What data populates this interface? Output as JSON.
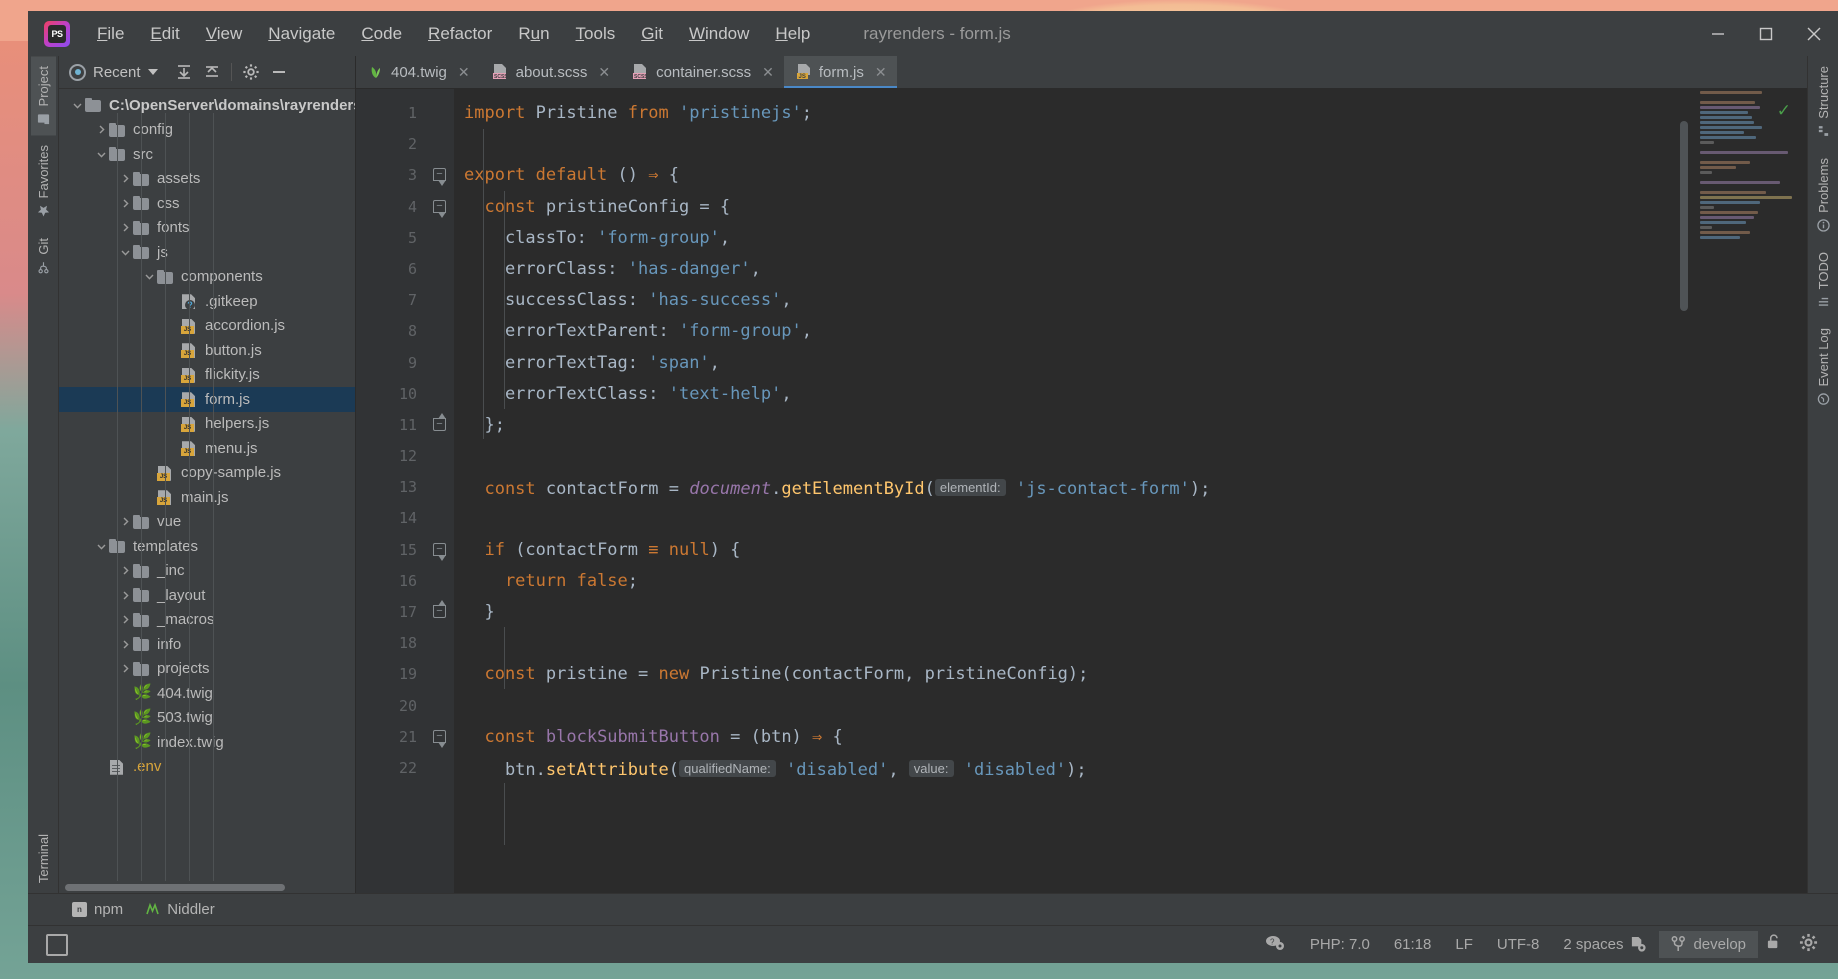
{
  "window": {
    "title": "rayrenders - form.js",
    "logo_label": "PS",
    "minimize": "–",
    "maximize": "□",
    "close": "✕"
  },
  "menubar": [
    {
      "label": "File",
      "mnemonic": "F"
    },
    {
      "label": "Edit",
      "mnemonic": "E"
    },
    {
      "label": "View",
      "mnemonic": "V"
    },
    {
      "label": "Navigate",
      "mnemonic": "N"
    },
    {
      "label": "Code",
      "mnemonic": "C"
    },
    {
      "label": "Refactor",
      "mnemonic": "R"
    },
    {
      "label": "Run",
      "mnemonic": "u"
    },
    {
      "label": "Tools",
      "mnemonic": "T"
    },
    {
      "label": "Git",
      "mnemonic": "G"
    },
    {
      "label": "Window",
      "mnemonic": "W"
    },
    {
      "label": "Help",
      "mnemonic": "H"
    }
  ],
  "left_strip": [
    {
      "label": "Project",
      "active": true,
      "icon": "project-icon"
    },
    {
      "label": "Favorites",
      "active": false,
      "icon": "star-icon"
    },
    {
      "label": "Git",
      "active": false,
      "icon": "branch-icon"
    }
  ],
  "left_strip_bottom": [
    {
      "label": "Terminal",
      "active": false,
      "icon": "terminal-icon"
    }
  ],
  "right_strip": [
    {
      "label": "Structure",
      "active": false,
      "icon": "structure-icon"
    },
    {
      "label": "Problems",
      "active": false,
      "icon": "warning-icon"
    },
    {
      "label": "TODO",
      "active": false,
      "icon": "todo-icon"
    },
    {
      "label": "Event Log",
      "active": false,
      "icon": "log-icon"
    }
  ],
  "project_panel": {
    "scope_label": "Recent",
    "toolbar_buttons": [
      {
        "name": "expand-all-button",
        "glyph": "⤓"
      },
      {
        "name": "collapse-all-button",
        "glyph": "⤒"
      },
      {
        "name": "settings-button",
        "glyph": "⚙"
      },
      {
        "name": "hide-button",
        "glyph": "—"
      }
    ],
    "tree": [
      {
        "label": "C:\\OpenServer\\domains\\rayrenders",
        "depth": 0,
        "arrow": "down",
        "icon": "folder",
        "bold": true,
        "selected": false
      },
      {
        "label": "config",
        "depth": 1,
        "arrow": "right",
        "icon": "folder",
        "bold": false,
        "selected": false
      },
      {
        "label": "src",
        "depth": 1,
        "arrow": "down",
        "icon": "folder",
        "bold": false,
        "selected": false
      },
      {
        "label": "assets",
        "depth": 2,
        "arrow": "right",
        "icon": "folder",
        "bold": false,
        "selected": false
      },
      {
        "label": "css",
        "depth": 2,
        "arrow": "right",
        "icon": "folder",
        "bold": false,
        "selected": false
      },
      {
        "label": "fonts",
        "depth": 2,
        "arrow": "right",
        "icon": "folder",
        "bold": false,
        "selected": false
      },
      {
        "label": "js",
        "depth": 2,
        "arrow": "down",
        "icon": "folder",
        "bold": false,
        "selected": false
      },
      {
        "label": "components",
        "depth": 3,
        "arrow": "down",
        "icon": "folder",
        "bold": false,
        "selected": false
      },
      {
        "label": ".gitkeep",
        "depth": 4,
        "arrow": "none",
        "icon": "gitkeep",
        "bold": false,
        "selected": false
      },
      {
        "label": "accordion.js",
        "depth": 4,
        "arrow": "none",
        "icon": "js",
        "bold": false,
        "selected": false
      },
      {
        "label": "button.js",
        "depth": 4,
        "arrow": "none",
        "icon": "js",
        "bold": false,
        "selected": false
      },
      {
        "label": "flickity.js",
        "depth": 4,
        "arrow": "none",
        "icon": "js",
        "bold": false,
        "selected": false
      },
      {
        "label": "form.js",
        "depth": 4,
        "arrow": "none",
        "icon": "js",
        "bold": false,
        "selected": true
      },
      {
        "label": "helpers.js",
        "depth": 4,
        "arrow": "none",
        "icon": "js",
        "bold": false,
        "selected": false
      },
      {
        "label": "menu.js",
        "depth": 4,
        "arrow": "none",
        "icon": "js",
        "bold": false,
        "selected": false
      },
      {
        "label": "copy-sample.js",
        "depth": 3,
        "arrow": "none",
        "icon": "js",
        "bold": false,
        "selected": false
      },
      {
        "label": "main.js",
        "depth": 3,
        "arrow": "none",
        "icon": "js",
        "bold": false,
        "selected": false
      },
      {
        "label": "vue",
        "depth": 2,
        "arrow": "right",
        "icon": "folder",
        "bold": false,
        "selected": false
      },
      {
        "label": "templates",
        "depth": 1,
        "arrow": "down",
        "icon": "folder",
        "bold": false,
        "selected": false
      },
      {
        "label": "_inc",
        "depth": 2,
        "arrow": "right",
        "icon": "folder",
        "bold": false,
        "selected": false
      },
      {
        "label": "_layout",
        "depth": 2,
        "arrow": "right",
        "icon": "folder",
        "bold": false,
        "selected": false
      },
      {
        "label": "_macros",
        "depth": 2,
        "arrow": "right",
        "icon": "folder",
        "bold": false,
        "selected": false
      },
      {
        "label": "info",
        "depth": 2,
        "arrow": "right",
        "icon": "folder",
        "bold": false,
        "selected": false
      },
      {
        "label": "projects",
        "depth": 2,
        "arrow": "right",
        "icon": "folder",
        "bold": false,
        "selected": false
      },
      {
        "label": "404.twig",
        "depth": 2,
        "arrow": "none",
        "icon": "twig",
        "bold": false,
        "selected": false
      },
      {
        "label": "503.twig",
        "depth": 2,
        "arrow": "none",
        "icon": "twig",
        "bold": false,
        "selected": false
      },
      {
        "label": "index.twig",
        "depth": 2,
        "arrow": "none",
        "icon": "twig",
        "bold": false,
        "selected": false
      },
      {
        "label": ".env",
        "depth": 1,
        "arrow": "none",
        "icon": "env",
        "bold": false,
        "selected": false
      }
    ]
  },
  "editor_tabs": [
    {
      "label": "404.twig",
      "icon": "twig",
      "active": false,
      "closable": true
    },
    {
      "label": "about.scss",
      "icon": "scss",
      "active": false,
      "closable": true
    },
    {
      "label": "container.scss",
      "icon": "scss",
      "active": false,
      "closable": true
    },
    {
      "label": "form.js",
      "icon": "js",
      "active": true,
      "closable": true
    }
  ],
  "editor": {
    "first_line": 1,
    "inspection_status": "✓",
    "lines": [
      {
        "n": 1,
        "fold": "",
        "segs": [
          {
            "t": "import ",
            "c": "kw"
          },
          {
            "t": "Pristine ",
            "c": "plain"
          },
          {
            "t": "from ",
            "c": "kw"
          },
          {
            "t": "'pristinejs'",
            "c": "str"
          },
          {
            "t": ";",
            "c": "plain"
          }
        ]
      },
      {
        "n": 2,
        "fold": "",
        "segs": []
      },
      {
        "n": 3,
        "fold": "open",
        "segs": [
          {
            "t": "export default ",
            "c": "kw"
          },
          {
            "t": "() ",
            "c": "plain"
          },
          {
            "t": "⇒",
            "c": "kw"
          },
          {
            "t": " {",
            "c": "plain"
          }
        ]
      },
      {
        "n": 4,
        "fold": "open",
        "indent": 1,
        "segs": [
          {
            "t": "  const ",
            "c": "kw"
          },
          {
            "t": "pristineConfig = {",
            "c": "plain"
          }
        ]
      },
      {
        "n": 5,
        "fold": "",
        "indent": 2,
        "segs": [
          {
            "t": "    classTo",
            "c": "plain"
          },
          {
            "t": ": ",
            "c": "plain"
          },
          {
            "t": "'form-group'",
            "c": "str"
          },
          {
            "t": ",",
            "c": "plain"
          }
        ]
      },
      {
        "n": 6,
        "fold": "",
        "indent": 2,
        "segs": [
          {
            "t": "    errorClass",
            "c": "plain"
          },
          {
            "t": ": ",
            "c": "plain"
          },
          {
            "t": "'has-danger'",
            "c": "str"
          },
          {
            "t": ",",
            "c": "plain"
          }
        ]
      },
      {
        "n": 7,
        "fold": "",
        "indent": 2,
        "segs": [
          {
            "t": "    successClass",
            "c": "plain"
          },
          {
            "t": ": ",
            "c": "plain"
          },
          {
            "t": "'has-success'",
            "c": "str"
          },
          {
            "t": ",",
            "c": "plain"
          }
        ]
      },
      {
        "n": 8,
        "fold": "",
        "indent": 2,
        "segs": [
          {
            "t": "    errorTextParent",
            "c": "plain"
          },
          {
            "t": ": ",
            "c": "plain"
          },
          {
            "t": "'form-group'",
            "c": "str"
          },
          {
            "t": ",",
            "c": "plain"
          }
        ]
      },
      {
        "n": 9,
        "fold": "",
        "indent": 2,
        "segs": [
          {
            "t": "    errorTextTag",
            "c": "plain"
          },
          {
            "t": ": ",
            "c": "plain"
          },
          {
            "t": "'span'",
            "c": "str"
          },
          {
            "t": ",",
            "c": "plain"
          }
        ]
      },
      {
        "n": 10,
        "fold": "",
        "indent": 2,
        "segs": [
          {
            "t": "    errorTextClass",
            "c": "plain"
          },
          {
            "t": ": ",
            "c": "plain"
          },
          {
            "t": "'text-help'",
            "c": "str"
          },
          {
            "t": ",",
            "c": "plain"
          }
        ]
      },
      {
        "n": 11,
        "fold": "close",
        "indent": 1,
        "segs": [
          {
            "t": "  };",
            "c": "plain"
          }
        ]
      },
      {
        "n": 12,
        "fold": "",
        "segs": []
      },
      {
        "n": 13,
        "fold": "",
        "indent": 1,
        "segs": [
          {
            "t": "  const ",
            "c": "kw"
          },
          {
            "t": "contactForm ",
            "c": "plain"
          },
          {
            "t": "= ",
            "c": "plain"
          },
          {
            "t": "document",
            "c": "doc"
          },
          {
            "t": ".",
            "c": "plain"
          },
          {
            "t": "getElementById",
            "c": "fn"
          },
          {
            "t": "(",
            "c": "plain"
          },
          {
            "t": "elementId:",
            "c": "hint"
          },
          {
            "t": " ",
            "c": "plain"
          },
          {
            "t": "'js-contact-form'",
            "c": "str"
          },
          {
            "t": ");",
            "c": "plain"
          }
        ]
      },
      {
        "n": 14,
        "fold": "",
        "segs": []
      },
      {
        "n": 15,
        "fold": "open",
        "indent": 1,
        "segs": [
          {
            "t": "  if ",
            "c": "kw"
          },
          {
            "t": "(contactForm ",
            "c": "plain"
          },
          {
            "t": "≡",
            "c": "kw"
          },
          {
            "t": " ",
            "c": "plain"
          },
          {
            "t": "null",
            "c": "kw"
          },
          {
            "t": ") {",
            "c": "plain"
          }
        ]
      },
      {
        "n": 16,
        "fold": "",
        "indent": 2,
        "segs": [
          {
            "t": "    return ",
            "c": "kw"
          },
          {
            "t": "false",
            "c": "kw"
          },
          {
            "t": ";",
            "c": "plain"
          }
        ]
      },
      {
        "n": 17,
        "fold": "close",
        "indent": 1,
        "segs": [
          {
            "t": "  }",
            "c": "plain"
          }
        ]
      },
      {
        "n": 18,
        "fold": "",
        "segs": []
      },
      {
        "n": 19,
        "fold": "",
        "indent": 1,
        "segs": [
          {
            "t": "  const ",
            "c": "kw"
          },
          {
            "t": "pristine ",
            "c": "plain"
          },
          {
            "t": "= ",
            "c": "plain"
          },
          {
            "t": "new ",
            "c": "kw"
          },
          {
            "t": "Pristine(contactForm, pristineConfig);",
            "c": "plain"
          }
        ]
      },
      {
        "n": 20,
        "fold": "",
        "segs": []
      },
      {
        "n": 21,
        "fold": "open",
        "indent": 1,
        "segs": [
          {
            "t": "  const ",
            "c": "kw"
          },
          {
            "t": "blockSubmitButton ",
            "c": "var"
          },
          {
            "t": "= ",
            "c": "plain"
          },
          {
            "t": "(btn) ",
            "c": "plain"
          },
          {
            "t": "⇒",
            "c": "kw"
          },
          {
            "t": " {",
            "c": "plain"
          }
        ]
      },
      {
        "n": 22,
        "fold": "",
        "indent": 2,
        "segs": [
          {
            "t": "    btn",
            "c": "plain"
          },
          {
            "t": ".",
            "c": "plain"
          },
          {
            "t": "setAttribute",
            "c": "fn"
          },
          {
            "t": "(",
            "c": "plain"
          },
          {
            "t": "qualifiedName:",
            "c": "hint"
          },
          {
            "t": " ",
            "c": "plain"
          },
          {
            "t": "'disabled'",
            "c": "str"
          },
          {
            "t": ", ",
            "c": "plain"
          },
          {
            "t": "value:",
            "c": "hint"
          },
          {
            "t": " ",
            "c": "plain"
          },
          {
            "t": "'disabled'",
            "c": "str"
          },
          {
            "t": ");",
            "c": "plain"
          }
        ]
      }
    ]
  },
  "bottom_bar": [
    {
      "label": "npm",
      "icon": "npm-icon"
    },
    {
      "label": "Niddler",
      "icon": "niddler-icon"
    }
  ],
  "status_bar": {
    "left_icon": "toggle-toolwindows-icon",
    "items": [
      {
        "name": "php-version",
        "label": "PHP: 7.0"
      },
      {
        "name": "caret-position",
        "label": "61:18"
      },
      {
        "name": "line-separator",
        "label": "LF"
      },
      {
        "name": "file-encoding",
        "label": "UTF-8"
      },
      {
        "name": "indentation",
        "label": "2 spaces"
      }
    ],
    "branch": "develop",
    "branch_icon": "git-branch-icon",
    "lock_icon": "unlocked-icon",
    "settings_icon": "gear-icon",
    "inspection_icon": "inspection-icon"
  },
  "colors": {
    "window_bg": "#3c3f41",
    "editor_bg": "#2b2b2b",
    "gutter_bg": "#313335",
    "accent": "#4a88c7",
    "selection": "#1b3a55",
    "string": "#6897bb",
    "keyword": "#cc7832",
    "function": "#ffc66d",
    "ok_green": "#4a9e4a",
    "js_badge": "#d8a53b"
  }
}
